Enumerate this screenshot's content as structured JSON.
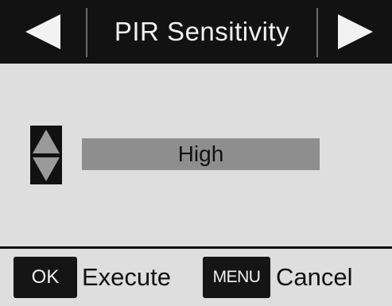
{
  "header": {
    "title": "PIR Sensitivity",
    "prev_icon": "left-triangle",
    "next_icon": "right-triangle"
  },
  "setting": {
    "value": "High",
    "up_icon": "up-triangle",
    "down_icon": "down-triangle"
  },
  "footer": {
    "ok_key": "OK",
    "ok_action": "Execute",
    "menu_key": "MENU",
    "menu_action": "Cancel"
  },
  "colors": {
    "header_bg": "#121212",
    "screen_bg": "#dedede",
    "value_highlight": "#8e8e8e",
    "key_bg": "#151515"
  }
}
